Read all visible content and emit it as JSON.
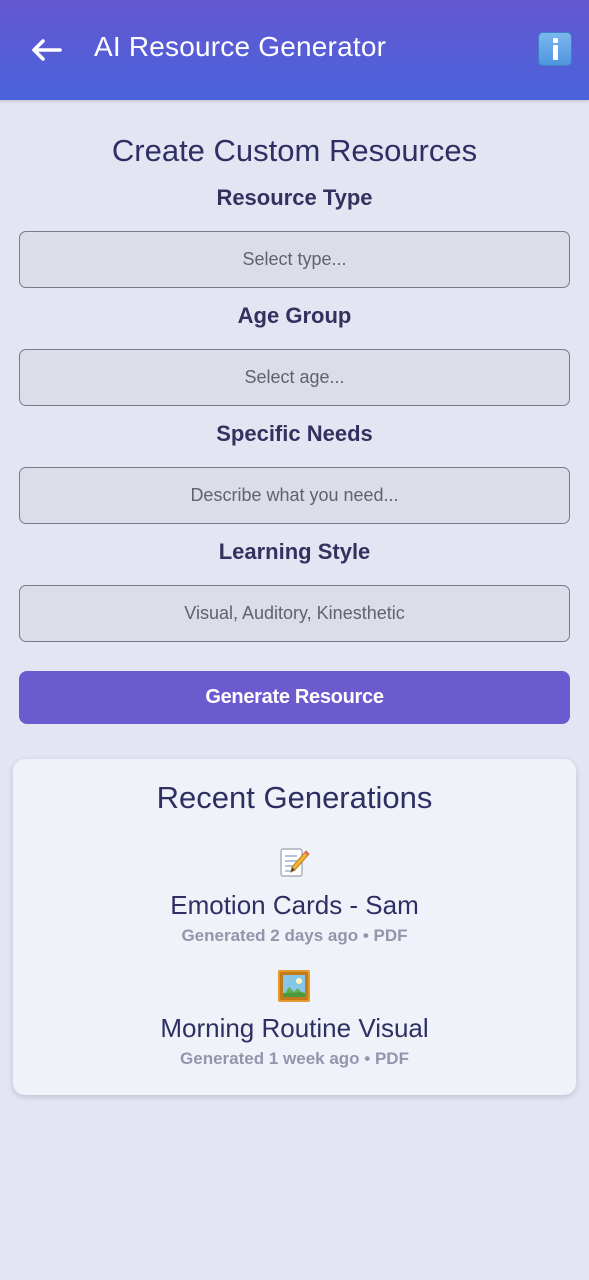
{
  "header": {
    "title": "AI Resource Generator",
    "back_icon": "arrow-left-icon",
    "info_icon": "info-icon",
    "gradient_top": "#6457d0",
    "gradient_bottom": "#4a63dc"
  },
  "form": {
    "title": "Create Custom Resources",
    "resource_type": {
      "label": "Resource Type",
      "placeholder": "Select type..."
    },
    "age_group": {
      "label": "Age Group",
      "placeholder": "Select age..."
    },
    "specific_needs": {
      "label": "Specific Needs",
      "placeholder": "Describe what you need..."
    },
    "learning_style": {
      "label": "Learning Style",
      "placeholder": "Visual, Auditory, Kinesthetic"
    },
    "generate_label": "Generate Resource",
    "accent_color": "#6b5bcf"
  },
  "recent": {
    "title": "Recent Generations",
    "items": [
      {
        "icon": "memo-pencil-icon",
        "name": "Emotion Cards - Sam",
        "meta": "Generated 2 days ago • PDF"
      },
      {
        "icon": "framed-picture-icon",
        "name": "Morning Routine Visual",
        "meta": "Generated 1 week ago • PDF"
      }
    ]
  }
}
